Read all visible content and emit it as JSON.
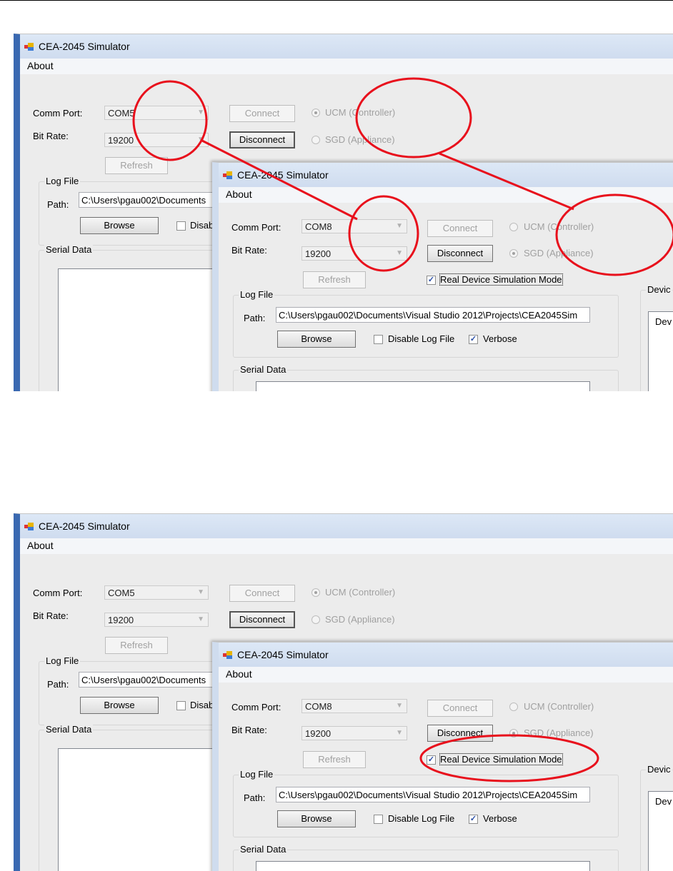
{
  "screenshots": [
    {
      "back_window": {
        "title": "CEA-2045 Simulator",
        "menu": "About",
        "comm_port_label": "Comm Port:",
        "comm_port_value": "COM5",
        "bit_rate_label": "Bit Rate:",
        "bit_rate_value": "19200",
        "connect_label": "Connect",
        "disconnect_label": "Disconnect",
        "refresh_label": "Refresh",
        "ucm_label": "UCM (Controller)",
        "sgd_label": "SGD (Appliance)",
        "log_file_label": "Log File",
        "path_label": "Path:",
        "path_value": "C:\\Users\\pgau002\\Documents",
        "browse_label": "Browse",
        "disable_label": "Disab",
        "serial_data_label": "Serial Data"
      },
      "front_window": {
        "title": "CEA-2045 Simulator",
        "menu": "About",
        "comm_port_label": "Comm Port:",
        "comm_port_value": "COM8",
        "bit_rate_label": "Bit Rate:",
        "bit_rate_value": "19200",
        "connect_label": "Connect",
        "disconnect_label": "Disconnect",
        "refresh_label": "Refresh",
        "ucm_label": "UCM (Controller)",
        "sgd_label": "SGD (Appliance)",
        "real_device_label": "Real Device Simulation Mode",
        "log_file_label": "Log File",
        "path_label": "Path:",
        "path_value": "C:\\Users\\pgau002\\Documents\\Visual Studio 2012\\Projects\\CEA2045Sim",
        "browse_label": "Browse",
        "disable_log_label": "Disable Log File",
        "verbose_label": "Verbose",
        "serial_data_label": "Serial Data",
        "device_group_label": "Devic",
        "device_box_text": "Dev"
      },
      "state": {
        "ucm_selected": true,
        "front_sgd_selected": true,
        "real_device_checked": true,
        "verbose_checked": true,
        "disable_log_checked": false
      }
    },
    {
      "back_window": {
        "title": "CEA-2045 Simulator",
        "menu": "About",
        "comm_port_label": "Comm Port:",
        "comm_port_value": "COM5",
        "bit_rate_label": "Bit Rate:",
        "bit_rate_value": "19200",
        "connect_label": "Connect",
        "disconnect_label": "Disconnect",
        "refresh_label": "Refresh",
        "ucm_label": "UCM (Controller)",
        "sgd_label": "SGD (Appliance)",
        "log_file_label": "Log File",
        "path_label": "Path:",
        "path_value": "C:\\Users\\pgau002\\Documents",
        "browse_label": "Browse",
        "disable_label": "Disab",
        "serial_data_label": "Serial Data"
      },
      "front_window": {
        "title": "CEA-2045 Simulator",
        "menu": "About",
        "comm_port_label": "Comm Port:",
        "comm_port_value": "COM8",
        "bit_rate_label": "Bit Rate:",
        "bit_rate_value": "19200",
        "connect_label": "Connect",
        "disconnect_label": "Disconnect",
        "refresh_label": "Refresh",
        "ucm_label": "UCM (Controller)",
        "sgd_label": "SGD (Appliance)",
        "real_device_label": "Real Device Simulation Mode",
        "log_file_label": "Log File",
        "path_label": "Path:",
        "path_value": "C:\\Users\\pgau002\\Documents\\Visual Studio 2012\\Projects\\CEA2045Sim",
        "browse_label": "Browse",
        "disable_log_label": "Disable Log File",
        "verbose_label": "Verbose",
        "serial_data_label": "Serial Data",
        "device_group_label": "Devic",
        "device_box_text": "Dev"
      },
      "state": {
        "ucm_selected": true,
        "front_sgd_selected": true,
        "real_device_checked": true,
        "verbose_checked": true,
        "disable_log_checked": false
      }
    }
  ],
  "annotation_color": "#e8101c",
  "check_glyph": "✓",
  "dropdown_glyph": "▼",
  "app_icon": "cea-app-icon"
}
